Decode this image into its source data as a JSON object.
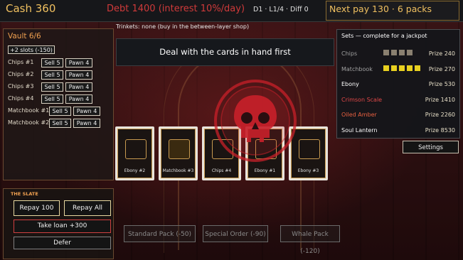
{
  "topbar": {
    "cash": "Cash 360",
    "debt": "Debt 1400 (interest 10%/day)",
    "diff": "D1 · L1/4 · Diff 0",
    "next_pay": "Next pay 130 · 6 packs"
  },
  "trinkets": "Trinkets: none (buy in the between-layer shop)",
  "message": "Deal with the cards in hand first",
  "vault": {
    "title": "Vault 6/6",
    "add_slots": "+2 slots (-150)",
    "rows": [
      {
        "label": "Chips #1",
        "sell": "Sell 5",
        "pawn": "Pawn 4"
      },
      {
        "label": "Chips #2",
        "sell": "Sell 5",
        "pawn": "Pawn 4"
      },
      {
        "label": "Chips #3",
        "sell": "Sell 5",
        "pawn": "Pawn 4"
      },
      {
        "label": "Chips #4",
        "sell": "Sell 5",
        "pawn": "Pawn 4"
      },
      {
        "label": "Matchbook #1",
        "sell": "Sell 5",
        "pawn": "Pawn 4"
      },
      {
        "label": "Matchbook #2",
        "sell": "Sell 5",
        "pawn": "Pawn 4"
      }
    ]
  },
  "slate": {
    "title": "THE SLATE",
    "repay_100": "Repay 100",
    "repay_all": "Repay All",
    "take_loan": "Take loan +300",
    "defer": "Defer"
  },
  "cards": [
    {
      "label": "Ebony",
      "num": "#2"
    },
    {
      "label": "Matchbook",
      "num": "#3"
    },
    {
      "label": "Chips",
      "num": "#4"
    },
    {
      "label": "Ebony",
      "num": "#1"
    },
    {
      "label": "Ebony",
      "num": "#3"
    }
  ],
  "sets": {
    "title": "Sets — complete for a jackpot",
    "items": [
      {
        "name": "Chips",
        "prize": "Prize 240",
        "color": "#a0a0a0",
        "filled": 0,
        "squares": 4,
        "fill_color": "#8a8070"
      },
      {
        "name": "Matchbook",
        "prize": "Prize 270",
        "color": "#a0a0a0",
        "filled": 5,
        "squares": 5,
        "fill_color": "#e8d020"
      },
      {
        "name": "Ebony",
        "prize": "Prize 530",
        "color": "#ffffff",
        "filled": 0,
        "squares": 0
      },
      {
        "name": "Crimson Scale",
        "prize": "Prize 1410",
        "color": "#e04848",
        "filled": 0,
        "squares": 0
      },
      {
        "name": "Oiled Amber",
        "prize": "Prize 2260",
        "color": "#e86040",
        "filled": 0,
        "squares": 0
      },
      {
        "name": "Soul Lantern",
        "prize": "Prize 8530",
        "color": "#ffffff",
        "filled": 0,
        "squares": 0
      }
    ]
  },
  "settings_label": "Settings",
  "shop": {
    "standard": "Standard Pack (-50)",
    "special": "Special Order (-90)",
    "whale": "Whale Pack (-120)"
  },
  "colors": {
    "gold": "#f0c060",
    "debt_red": "#d03a3a",
    "skull_red": "#c8202a"
  }
}
